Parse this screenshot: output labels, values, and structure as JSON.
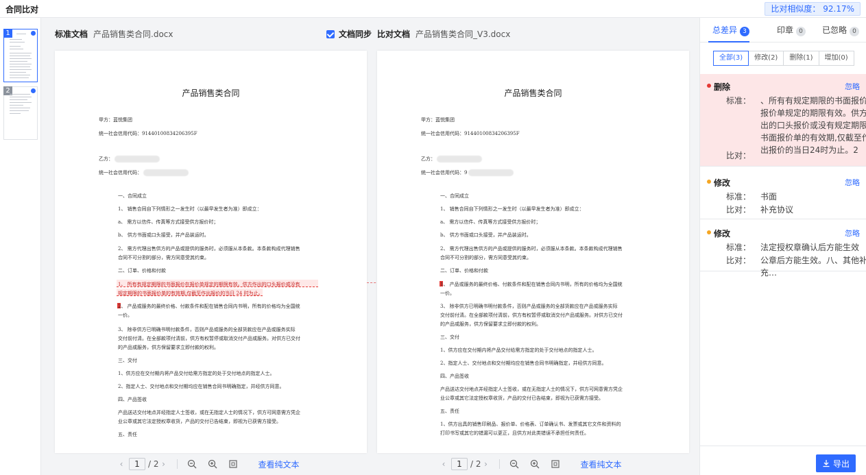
{
  "app": {
    "title": "合同比对",
    "similarity": "比对相似度： 92.17%"
  },
  "thumbs": [
    {
      "num": "1"
    },
    {
      "num": "2"
    }
  ],
  "left_doc": {
    "label": "标准文档",
    "file": "产品销售类合同.docx"
  },
  "sync": {
    "label": "文档同步"
  },
  "right_doc": {
    "label": "比对文档",
    "file": "产品销售类合同_V3.docx"
  },
  "doc_title": "产品销售类合同",
  "left_lines": [
    "甲方：蓝悦集团",
    "统一社会信用代码：91440100834206395F",
    "乙方：",
    "统一社会信用代码：",
    "一、合同成立",
    "1、 销售合同自下列情形之一发生时（以最早发生者为准）即成立：",
    "a、 需方以信件、传真等方式接受供方报价时；",
    "b、 供方书面或口头接受，并产品装运时。",
    "2、 需方代理出售供方的产品或提供的服务时，必须服从本条款。本条款构成代理销售",
    "合同不可分割的部分，需方同意受其约束。",
    "二、订单、价格和付款",
    "1、 所有有规定期限的书面报价在报价单规定的期限有效。供方作出的口头报价或没有",
    "规定期限的书面报价单的有效期,仅截至作出报价的当日 24 时为止。",
    "2、 产品或服务的最终价格、付款条件和配在销售合同内书明，所有的价格均为全国统",
    "一价。",
    "3、 除非供方已明确书明付款条件，否则产品或服务的全部货款应在产品或服务实际",
    "交付前付清。在全部款项付清前，供方有权暂停或取消交付产品或服务。对供方已交付",
    "的产品或服务，供方保留要求立即付款的权利。",
    "三、交付",
    "1、供方应在交付期内将产品交付给需方指定的处于交付地点的指定人士。",
    "2、指定人士、交付地点和交付期均应在销售合同书明确指定，并经供方同意。",
    "四、产品签收",
    "产品送达交付地点并经指定人士签收，或在无指定人士的情况下，供方可网意需方凭企",
    "业公章或其它法定授权章收货，产品的交付已告结束，即视为已获需方接受。",
    "五、责任"
  ],
  "right_lines": [
    "甲方：蓝悦集团",
    "统一社会信用代码：91440100834206395F",
    "乙方：",
    "统一社会信用代码：9",
    "一、合同成立",
    "1、 销售合同自下列情形之一发生时（以最早发生者为准）即成立：",
    "a、 需方以信件、传真等方式接受供方报价时；",
    "b、 供方书面或口头接受，并产品装运时。",
    "2、 需方代理出售供方的产品或提供的服务时，必须服从本条款。本条款构成代理销售",
    "合同不可分割的部分，需方同意受其约束。",
    "二、订单、价格和付款",
    "1、 产品或服务的最终价格、付款条件和配在销售合同内书明，所有的价格均为全国统",
    "一价。",
    "3、 除非供方已明确书明付款条件，否则产品或服务的全部货款应在产品或服务实际",
    "交付前付清。在全部款项付清前，供方有权暂停或取消交付产品或服务。对供方已交付",
    "的产品或服务，供方保留要求立即付款的权利。",
    "三、交付",
    "1、供方应在交付期内将产品交付给需方指定的处于交付地点的指定人士。",
    "2、指定人士、交付地点和交付期均应在销售合同书明确指定，并经供方同意。",
    "四、产品签收",
    "产品送达交付地点并经指定人士签收，或在无指定人士的情况下，供方可网意需方凭企",
    "业公章或其它法定授权章收货，产品的交付已告结束，即视为已获需方接受。",
    "五、责任",
    "1、供方出具的销售印刷品、报价单、价格表、订单确认书、发票或其它文件和资料的",
    "打印书写或其它的错漏可以更正，且供方对此类错误不承担任何责任。"
  ],
  "pager": {
    "current": "1",
    "total": "/ 2",
    "view_text": "查看纯文本"
  },
  "panel": {
    "tabs": [
      {
        "label": "总差异",
        "count": "3"
      },
      {
        "label": "印章",
        "count": "0"
      },
      {
        "label": "已忽略",
        "count": "0"
      }
    ],
    "filters": [
      "全部(3)",
      "修改(2)",
      "删除(1)",
      "增加(0)"
    ],
    "cards": [
      {
        "type": "删除",
        "ignore": "忽略",
        "std_label": "标准：",
        "std_value": "、所有有规定期限的书面报价在报价单规定的期限有效。供方作出的口头报价或没有规定期限的书面报价单的有效期,仅截至作出报价的当日24时为止。2",
        "cmp_label": "比对：",
        "cmp_value": ""
      },
      {
        "type": "修改",
        "ignore": "忽略",
        "std_label": "标准：",
        "std_value": "书面",
        "cmp_label": "比对：",
        "cmp_value": "补充协议"
      },
      {
        "type": "修改",
        "ignore": "忽略",
        "std_label": "标准：",
        "std_value": "法定授权章确认后方能生效",
        "cmp_label": "比对：",
        "cmp_value": "公章后方能生效。八、其他补充…"
      }
    ],
    "export": "导出"
  },
  "colors": {
    "accent": "#2f6bff",
    "delete": "#e53935",
    "modify": "#f5a623",
    "delete_bg": "#fde6e7"
  }
}
